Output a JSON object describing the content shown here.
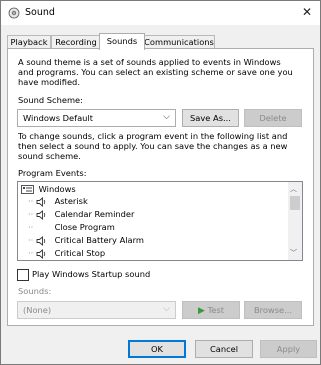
{
  "window": {
    "title": "Sound"
  },
  "tabs": [
    {
      "label": "Playback"
    },
    {
      "label": "Recording"
    },
    {
      "label": "Sounds"
    },
    {
      "label": "Communications"
    }
  ],
  "intro_text": [
    "A sound theme is a set of sounds applied to events in Windows",
    "and programs.  You can select an existing scheme or save one you",
    "have modified."
  ],
  "scheme": {
    "label": "Sound Scheme:",
    "value": "Windows Default",
    "save_as": "Save As...",
    "delete": "Delete"
  },
  "instructions": [
    "To change sounds, click a program event in the following list and",
    "then select a sound to apply.  You can save the changes as a new",
    "sound scheme."
  ],
  "events": {
    "label": "Program Events:",
    "group": "Windows",
    "items": [
      {
        "label": "Asterisk",
        "has_sound": true
      },
      {
        "label": "Calendar Reminder",
        "has_sound": true
      },
      {
        "label": "Close Program",
        "has_sound": false
      },
      {
        "label": "Critical Battery Alarm",
        "has_sound": true
      },
      {
        "label": "Critical Stop",
        "has_sound": true
      }
    ]
  },
  "startup": {
    "label": "Play Windows Startup sound",
    "checked": false
  },
  "sounds": {
    "label": "Sounds:",
    "value": "(None)",
    "test": "Test",
    "browse": "Browse..."
  },
  "footer": {
    "ok": "OK",
    "cancel": "Cancel",
    "apply": "Apply"
  },
  "colors": {
    "accent": "#0078d7",
    "panel": "#ffffff",
    "chrome": "#f0f0f0"
  }
}
